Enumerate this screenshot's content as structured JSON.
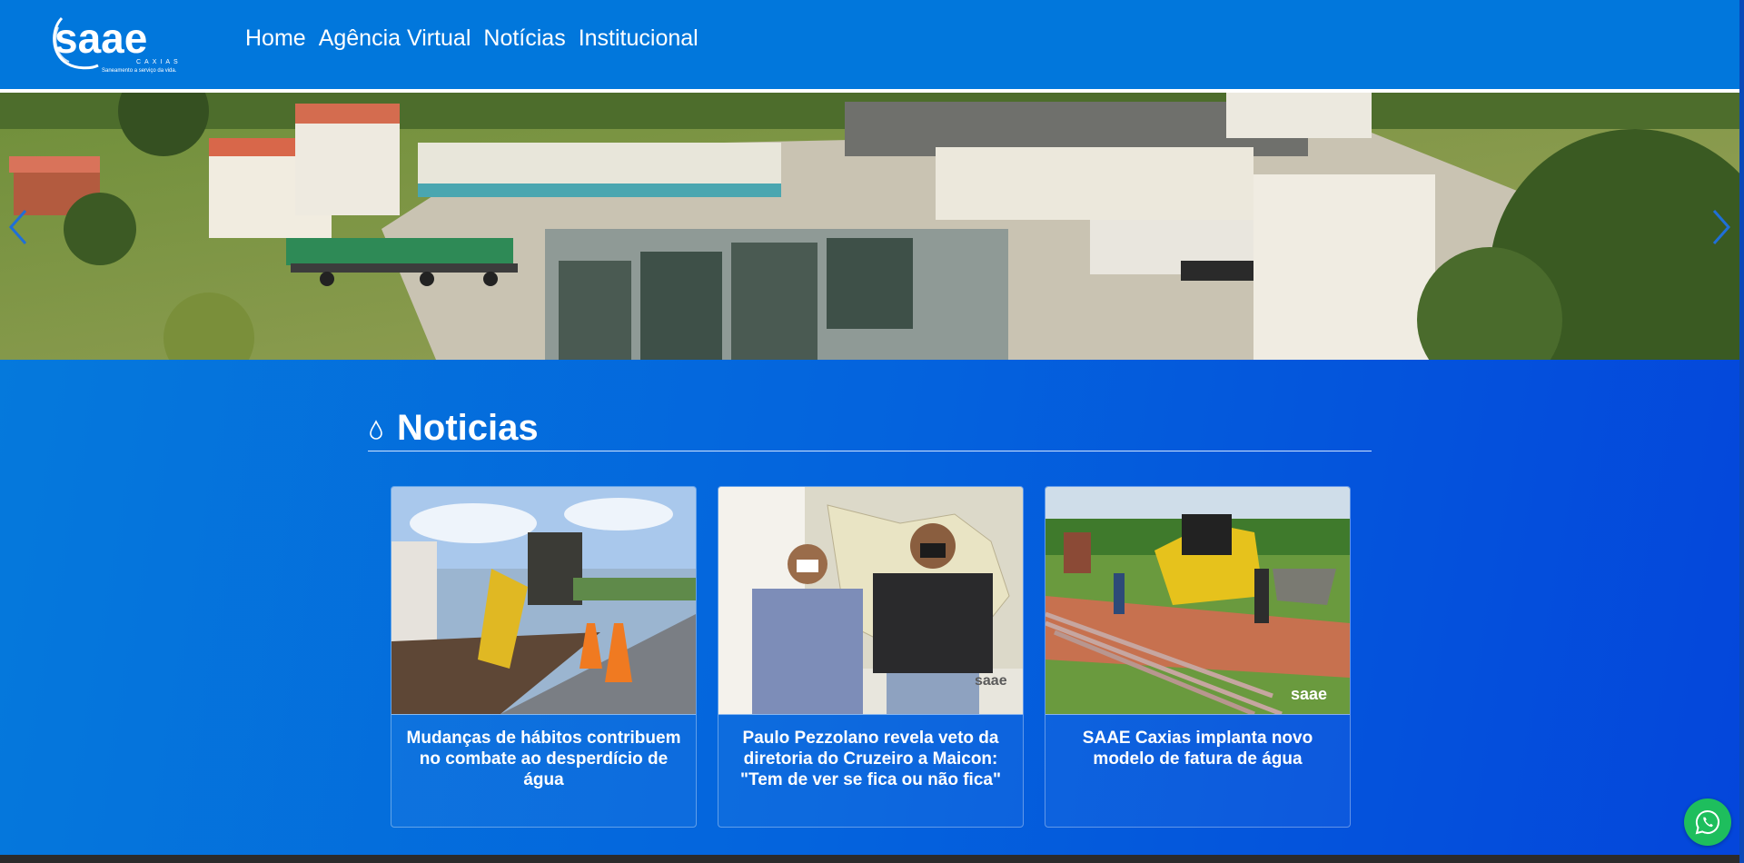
{
  "header": {
    "logo_text": "saae",
    "logo_sub": "CAXIAS",
    "logo_tagline": "Saneamento a serviço da vida.",
    "nav": [
      {
        "label": "Home"
      },
      {
        "label": "Agência Virtual"
      },
      {
        "label": "Notícias"
      },
      {
        "label": "Institucional"
      }
    ]
  },
  "hero": {
    "icons": {
      "prev": "chevron-left-icon",
      "next": "chevron-right-icon"
    }
  },
  "news": {
    "section_title": "Noticias",
    "section_icon": "water-drop-icon",
    "cards": [
      {
        "title": "Mudanças de hábitos contribuem no combate ao desperdício de água"
      },
      {
        "title": "Paulo Pezzolano revela veto da diretoria do Cruzeiro a Maicon: \"Tem de ver se fica ou não fica\"",
        "watermark": "saae"
      },
      {
        "title": "SAAE Caxias implanta novo modelo de fatura de água",
        "watermark": "saae"
      }
    ]
  },
  "whatsapp": {
    "icon": "whatsapp-icon"
  },
  "colors": {
    "header": "#0177dc",
    "main": "#0463dd",
    "whatsapp": "#1ebe5d"
  }
}
